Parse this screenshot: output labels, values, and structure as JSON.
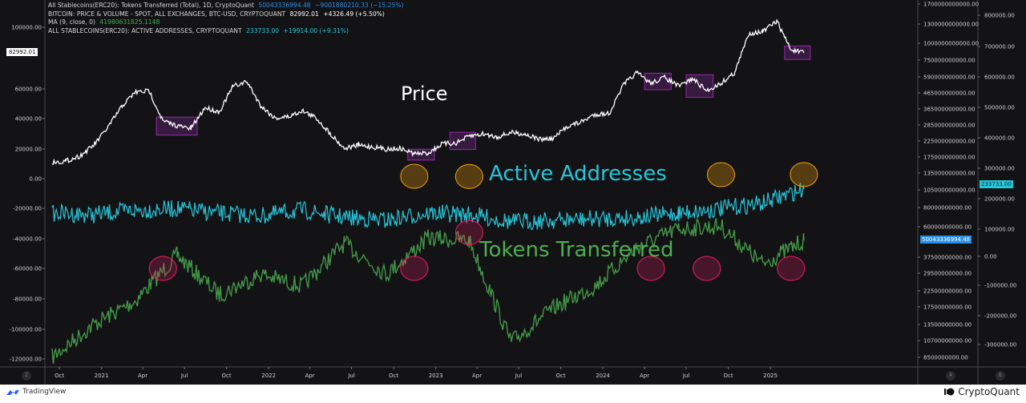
{
  "legend": {
    "rows": [
      {
        "label": "All Stablecoins(ERC20): Tokens Transferred (Total), 1D, CryptoQuant",
        "value": "50043336994.48",
        "change": "−9001880210.33 (−15.25%)",
        "color": "#2b8ee8"
      },
      {
        "label": "BITCOIN: PRICE & VOLUME - SPOT, ALL EXCHANGES, BTC-USD, CRYPTOQUANT",
        "value": "82992.01",
        "change": "+4326.49 (+5.50%)",
        "color": "#ffffff"
      },
      {
        "label": "MA (9, close, 0)",
        "value": "41980631825.1148",
        "change": "",
        "color": "#3fae47"
      },
      {
        "label": "ALL STABLECOINS(ERC20): ACTIVE ADDRESSES, CRYPTOQUANT",
        "value": "233733.00",
        "change": "+19914.00 (+9.31%)",
        "color": "#26c6da"
      }
    ]
  },
  "price_tag": "82992.01",
  "active_tag": "233733.00",
  "tokens_tag": "50043336994.48",
  "annotations": {
    "price": "Price",
    "active": "Active Addresses",
    "tokens": "Tokens Transferred"
  },
  "scale_buttons": {
    "left": "Z",
    "a": "A",
    "b": "B"
  },
  "branding": {
    "left": "TradingView",
    "right": "CryptoQuant"
  },
  "chart_data": {
    "type": "line",
    "title": "",
    "x_ticks": [
      "Oct",
      "2021",
      "Apr",
      "Jul",
      "Oct",
      "2022",
      "Apr",
      "Jul",
      "Oct",
      "2023",
      "Apr",
      "Jul",
      "Oct",
      "2024",
      "Apr",
      "Jul",
      "Oct",
      "2025"
    ],
    "left_axis": {
      "ticks": [
        "100000.00",
        "60000.00",
        "40000.00",
        "20000.00",
        "0.00",
        "-20000.00",
        "-40000.00",
        "-60000.00",
        "-80000.00",
        "-100000.00",
        "-120000.00"
      ],
      "range": [
        -125000,
        110000
      ]
    },
    "axis_a": {
      "ticks": [
        "1700000000000.00",
        "1300000000000.00",
        "1000000000000.00",
        "750000000000.00",
        "590000000000.00",
        "465000000000.00",
        "365000000000.00",
        "285000000000.00",
        "225000000000.00",
        "175000000000.00",
        "135000000000.00",
        "105000000000.00",
        "80000000000.00",
        "60000000000.00",
        "37500000000.00",
        "29500000000.00",
        "22500000000.00",
        "17500000000.00",
        "13500000000.00",
        "10700000000.00",
        "8500000000.00"
      ],
      "scale": "log"
    },
    "axis_b": {
      "ticks": [
        "800000.00",
        "700000.00",
        "600000.00",
        "500000.00",
        "400000.00",
        "300000.00",
        "200000.00",
        "100000.00",
        "0.00",
        "-100000.00",
        "-200000.00",
        "-300000.00"
      ],
      "range": [
        -340000,
        820000
      ]
    },
    "series": [
      {
        "name": "BTC Price",
        "color": "#ffffff",
        "axis": "left",
        "x": [
          "2020-09",
          "2020-10",
          "2020-11",
          "2020-12",
          "2021-01",
          "2021-02",
          "2021-03",
          "2021-04",
          "2021-05",
          "2021-06",
          "2021-07",
          "2021-08",
          "2021-09",
          "2021-10",
          "2021-11",
          "2021-12",
          "2022-01",
          "2022-02",
          "2022-03",
          "2022-04",
          "2022-05",
          "2022-06",
          "2022-07",
          "2022-08",
          "2022-09",
          "2022-10",
          "2022-11",
          "2022-12",
          "2023-01",
          "2023-02",
          "2023-03",
          "2023-04",
          "2023-05",
          "2023-06",
          "2023-07",
          "2023-08",
          "2023-09",
          "2023-10",
          "2023-11",
          "2023-12",
          "2024-01",
          "2024-02",
          "2024-03",
          "2024-04",
          "2024-05",
          "2024-06",
          "2024-07",
          "2024-08",
          "2024-09",
          "2024-10",
          "2024-11",
          "2024-12",
          "2025-01",
          "2025-02",
          "2025-03"
        ],
        "values": [
          10800,
          11500,
          15000,
          22000,
          34000,
          48000,
          57000,
          58000,
          38000,
          35000,
          33000,
          47000,
          44000,
          61000,
          64000,
          48000,
          40000,
          41000,
          45000,
          40000,
          30000,
          20000,
          22000,
          21000,
          19500,
          20000,
          16500,
          16800,
          23000,
          23500,
          28000,
          29500,
          27500,
          30500,
          29500,
          26000,
          26500,
          34500,
          37500,
          42500,
          43000,
          62000,
          70000,
          63000,
          67000,
          61000,
          66000,
          58000,
          63000,
          70000,
          96000,
          97000,
          104000,
          85000,
          83000
        ]
      },
      {
        "name": "Active Addresses",
        "color": "#26c6da",
        "axis": "b",
        "x": [
          "2020-09",
          "2020-12",
          "2021-03",
          "2021-06",
          "2021-09",
          "2021-12",
          "2022-03",
          "2022-06",
          "2022-09",
          "2022-12",
          "2023-03",
          "2023-06",
          "2023-09",
          "2023-12",
          "2024-03",
          "2024-06",
          "2024-09",
          "2024-12",
          "2025-03"
        ],
        "values": [
          150000,
          145000,
          160000,
          165000,
          150000,
          140000,
          160000,
          135000,
          125000,
          150000,
          145000,
          120000,
          125000,
          130000,
          135000,
          150000,
          165000,
          185000,
          233733
        ]
      },
      {
        "name": "Tokens Transferred",
        "color": "#4caf50",
        "axis": "a",
        "x": [
          "2020-09",
          "2020-12",
          "2021-03",
          "2021-06",
          "2021-09",
          "2021-12",
          "2022-03",
          "2022-06",
          "2022-09",
          "2022-12",
          "2023-03",
          "2023-06",
          "2023-09",
          "2023-12",
          "2024-03",
          "2024-06",
          "2024-09",
          "2024-12",
          "2025-03"
        ],
        "values": [
          8500000000,
          14000000000,
          20000000000,
          40000000000,
          22000000000,
          30000000000,
          25000000000,
          48000000000,
          30000000000,
          52000000000,
          50000000000,
          10700000000,
          18000000000,
          25000000000,
          45000000000,
          60000000000,
          62000000000,
          35000000000,
          50043336994
        ]
      }
    ],
    "highlight_boxes": [
      {
        "series": "BTC Price",
        "period": [
          "2021-05",
          "2021-07"
        ]
      },
      {
        "series": "BTC Price",
        "period": [
          "2022-11",
          "2022-12"
        ]
      },
      {
        "series": "BTC Price",
        "period": [
          "2023-02",
          "2023-03"
        ]
      },
      {
        "series": "BTC Price",
        "period": [
          "2024-04",
          "2024-05"
        ]
      },
      {
        "series": "BTC Price",
        "period": [
          "2024-07",
          "2024-08"
        ]
      },
      {
        "series": "BTC Price",
        "period": [
          "2025-02",
          "2025-03"
        ]
      }
    ],
    "highlight_circles": [
      {
        "series": "Active Addresses",
        "date": "2022-11",
        "color": "#f59e0b"
      },
      {
        "series": "Active Addresses",
        "date": "2023-03",
        "color": "#f59e0b"
      },
      {
        "series": "Active Addresses",
        "date": "2024-09",
        "color": "#f59e0b"
      },
      {
        "series": "Active Addresses",
        "date": "2025-03",
        "color": "#f59e0b"
      },
      {
        "series": "Tokens Transferred",
        "date": "2021-05",
        "color": "#e91e63"
      },
      {
        "series": "Tokens Transferred",
        "date": "2022-11",
        "color": "#e91e63"
      },
      {
        "series": "Tokens Transferred",
        "date": "2023-03",
        "color": "#e91e63"
      },
      {
        "series": "Tokens Transferred",
        "date": "2024-04",
        "color": "#e91e63"
      },
      {
        "series": "Tokens Transferred",
        "date": "2024-08",
        "color": "#e91e63"
      },
      {
        "series": "Tokens Transferred",
        "date": "2025-02",
        "color": "#e91e63"
      }
    ],
    "grid": false
  }
}
